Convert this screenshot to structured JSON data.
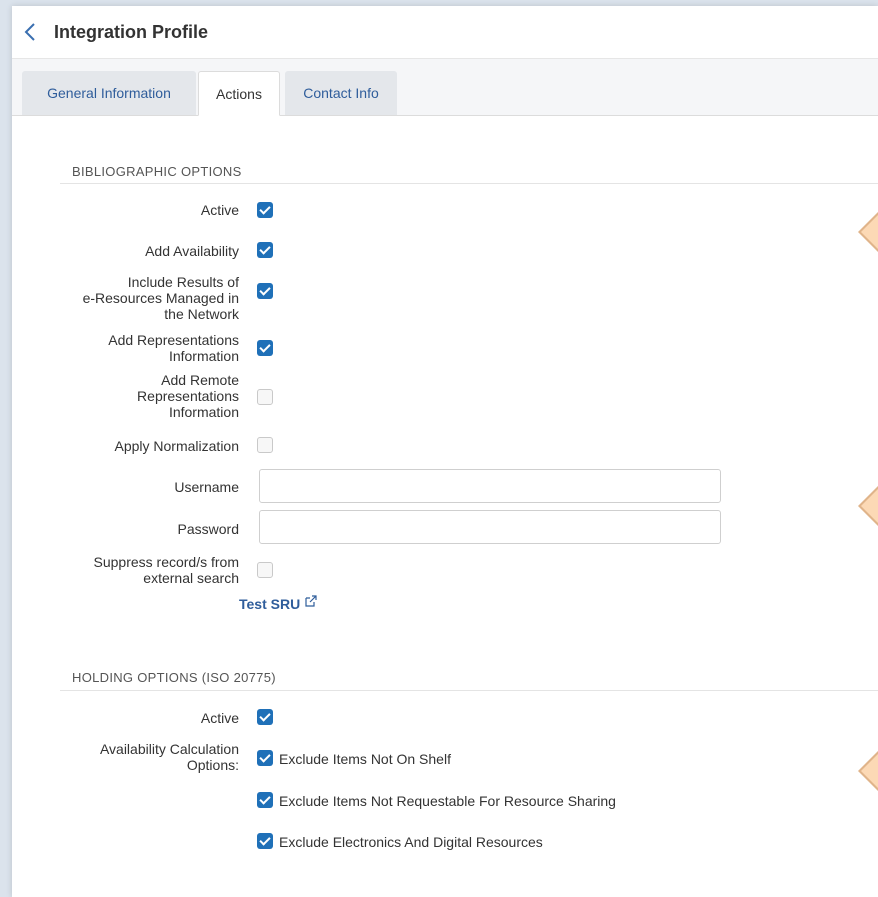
{
  "header": {
    "title": "Integration Profile"
  },
  "tabs": [
    {
      "label": "General Information"
    },
    {
      "label": "Actions"
    },
    {
      "label": "Contact Info"
    }
  ],
  "bibliographic": {
    "title": "BIBLIOGRAPHIC OPTIONS",
    "active": "Active",
    "add_availability": "Add Availability",
    "include_results_l1": "Include Results of",
    "include_results_l2": "e-Resources Managed in",
    "include_results_l3": "the Network",
    "add_repr_l1": "Add Representations",
    "add_repr_l2": "Information",
    "add_remote_l1": "Add Remote",
    "add_remote_l2": "Representations",
    "add_remote_l3": "Information",
    "apply_normalization": "Apply Normalization",
    "username": "Username",
    "password": "Password",
    "suppress_l1": "Suppress record/s from",
    "suppress_l2": "external search",
    "test_sru": "Test SRU"
  },
  "holding": {
    "title": "HOLDING OPTIONS (ISO 20775)",
    "active": "Active",
    "calc_l1": "Availability Calculation",
    "calc_l2": "Options:",
    "opt1": "Exclude Items Not On Shelf",
    "opt2": "Exclude Items Not Requestable For Resource Sharing",
    "opt3": "Exclude Electronics And Digital Resources"
  },
  "icons": {
    "back": "chevron-left-icon",
    "external": "external-link-icon"
  },
  "colors": {
    "accent": "#1f70b8",
    "link": "#2f5d9b"
  }
}
